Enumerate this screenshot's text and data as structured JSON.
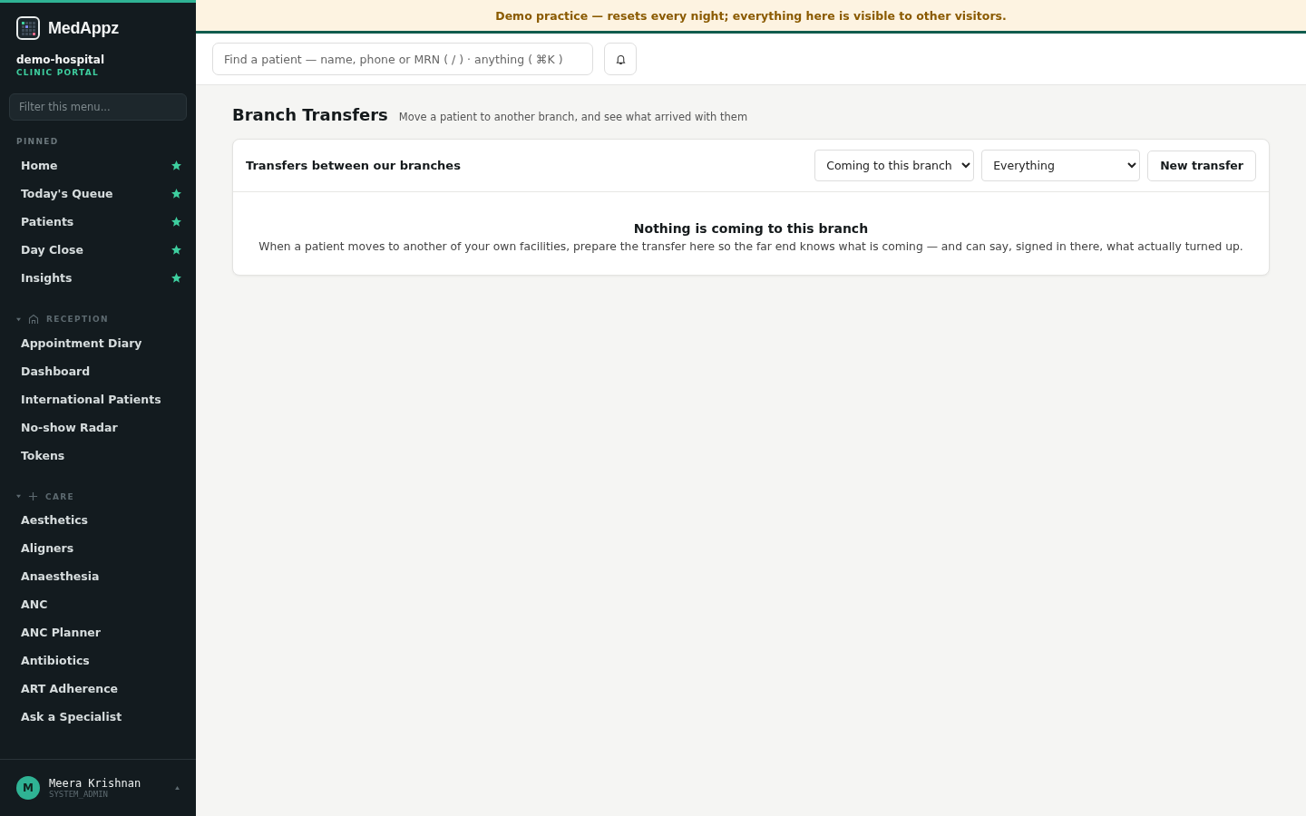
{
  "brand": {
    "name": "MedAppz",
    "tenant": "demo-hospital",
    "portal": "CLINIC PORTAL"
  },
  "sidebar": {
    "filter_placeholder": "Filter this menu...",
    "pinned": {
      "title": "PINNED",
      "items": [
        {
          "label": "Home",
          "starred": true
        },
        {
          "label": "Today's Queue",
          "starred": true
        },
        {
          "label": "Patients",
          "starred": true
        },
        {
          "label": "Day Close",
          "starred": true
        },
        {
          "label": "Insights",
          "starred": true
        }
      ]
    },
    "sections": [
      {
        "title": "RECEPTION",
        "kind": "building",
        "expanded": true,
        "items": [
          "Appointment Diary",
          "Dashboard",
          "International Patients",
          "No-show Radar",
          "Tokens"
        ]
      },
      {
        "title": "CARE",
        "kind": "plus",
        "expanded": true,
        "items": [
          "Aesthetics",
          "Aligners",
          "Anaesthesia",
          "ANC",
          "ANC Planner",
          "Antibiotics",
          "ART Adherence",
          "Ask a Specialist"
        ]
      }
    ],
    "user": {
      "initial": "M",
      "name": "Meera Krishnan",
      "role": "SYSTEM_ADMIN"
    }
  },
  "banner": "Demo practice — resets every night; everything here is visible to other visitors.",
  "search": {
    "placeholder": "Find a patient — name, phone or MRN ( / ) · anything ( ⌘K )"
  },
  "page": {
    "title": "Branch Transfers",
    "subtitle": "Move a patient to another branch, and see what arrived with them"
  },
  "card": {
    "title": "Transfers between our branches",
    "direction": "Coming to this branch",
    "filter": "Everything",
    "button": "New transfer",
    "empty_title": "Nothing is coming to this branch",
    "empty_text": "When a patient moves to another of your own facilities, prepare the transfer here so the far end knows what is coming — and can say, signed in there, what actually turned up."
  }
}
